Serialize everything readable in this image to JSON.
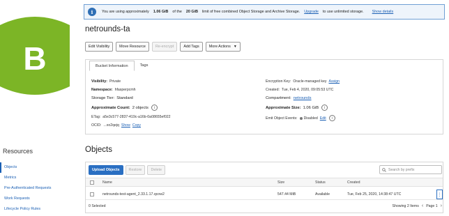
{
  "brand": {
    "letter": "B",
    "color": "#7cb526"
  },
  "banner": {
    "pre": "You are using approximately",
    "used": "1.06 GiB",
    "mid": "of the",
    "limit": "20 GiB",
    "post": "limit of free combined Object Storage and Archive Storage.",
    "upgrade_link": "Upgrade",
    "upgrade_post": "to use unlimited storage.",
    "details_link": "Show details"
  },
  "bucket": {
    "name": "netrounds-ta"
  },
  "actions": {
    "edit_visibility": "Edit Visibility",
    "move_resource": "Move Resource",
    "re_encrypt": "Re-encrypt",
    "add_tags": "Add Tags",
    "more_actions": "More Actions"
  },
  "tabs": {
    "bucket_info": "Bucket Information",
    "tags": "Tags"
  },
  "details": {
    "visibility": {
      "label": "Visibility:",
      "value": "Private"
    },
    "namespace": {
      "label": "Namespace:",
      "value": "hfasperpcmh"
    },
    "storage_tier": {
      "label": "Storage Tier:",
      "value": "Standard"
    },
    "approx_count": {
      "label": "Approximate Count:",
      "value": "2 objects"
    },
    "etag": {
      "label": "ETag:",
      "value": "a5e3c577-2837-419c-a16b-0a08655ef022"
    },
    "ocid": {
      "label": "OCID:",
      "value": "...xo2qejq",
      "show": "Show",
      "copy": "Copy"
    },
    "encryption": {
      "label": "Encryption Key:",
      "value": "Oracle-managed key",
      "link": "Assign"
    },
    "created": {
      "label": "Created:",
      "value": "Tue, Feb 4, 2020, 09:05:53 UTC"
    },
    "compartment": {
      "label": "Compartment:",
      "value": "netrounds"
    },
    "approx_size": {
      "label": "Approximate Size:",
      "value": "1.06 GiB"
    },
    "emit_events": {
      "label": "Emit Object Events:",
      "value": "Disabled",
      "link": "Edit"
    }
  },
  "resources": {
    "heading": "Resources",
    "items": [
      {
        "label": "Objects"
      },
      {
        "label": "Metrics"
      },
      {
        "label": "Pre-Authenticated Requests"
      },
      {
        "label": "Work Requests"
      },
      {
        "label": "Lifecycle Policy Rules"
      }
    ]
  },
  "objects": {
    "heading": "Objects",
    "upload": "Upload Objects",
    "restore": "Restore",
    "delete": "Delete",
    "search_placeholder": "Search by prefix",
    "columns": {
      "name": "Name",
      "size": "Size",
      "status": "Status",
      "created": "Created"
    },
    "rows": [
      {
        "name": "netrounds-test-agent_2.33.1.17.qcow2",
        "size": "547.44 MiB",
        "status": "Available",
        "created": "Tue, Feb 25, 2020, 14:38:47 UTC"
      }
    ],
    "selected": "0 Selected",
    "showing": "Showing 2 Items",
    "page": "Page 1"
  }
}
